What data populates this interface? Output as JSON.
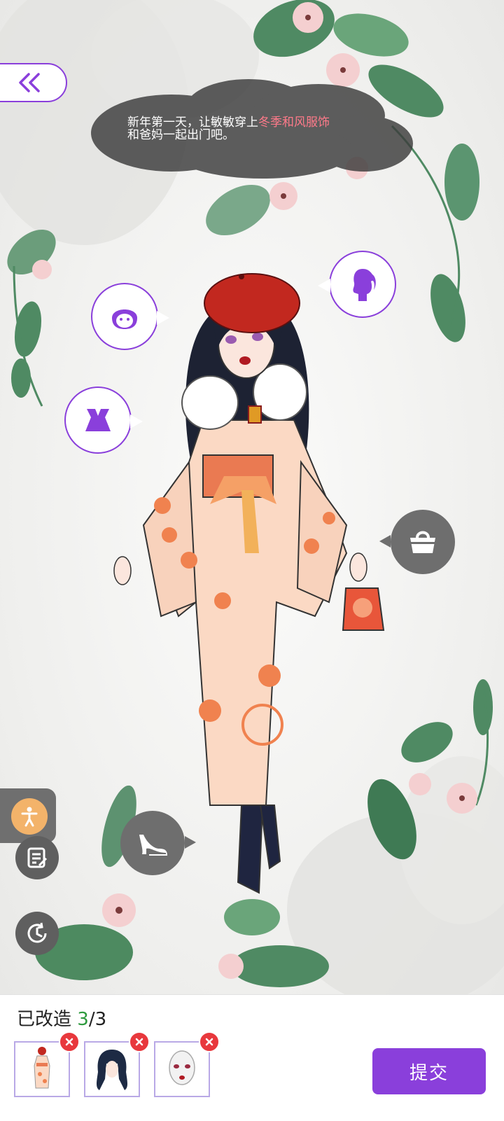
{
  "scene": {
    "dialogue": {
      "text_before": "新年第一天，让敏敏穿上",
      "highlight": "冬季和风服饰",
      "line2": "和爸妈一起出门吧。"
    },
    "icons": {
      "back": "double-chevron-left-icon",
      "face": "face-icon",
      "hair": "ponytail-head-icon",
      "clothing": "dress-icon",
      "bag": "handbag-icon",
      "shoes": "high-heel-icon",
      "pose": "person-pose-icon",
      "notes": "notes-icon",
      "history": "clock-history-icon"
    }
  },
  "footer": {
    "modified_label": "已改造",
    "modified_current": "3",
    "modified_sep_total": "/3",
    "items": [
      {
        "name": "kimono outfit",
        "icon": "outfit-thumbnail"
      },
      {
        "name": "long dark hair",
        "icon": "hair-thumbnail"
      },
      {
        "name": "face makeup",
        "icon": "face-thumbnail"
      }
    ],
    "remove_icon": "close-icon",
    "submit_label": "提交"
  },
  "colors": {
    "accent": "#8a3fdb",
    "counter_current": "#2e9a3e",
    "highlight_text": "#ff7a8a",
    "remove": "#e8383d"
  }
}
